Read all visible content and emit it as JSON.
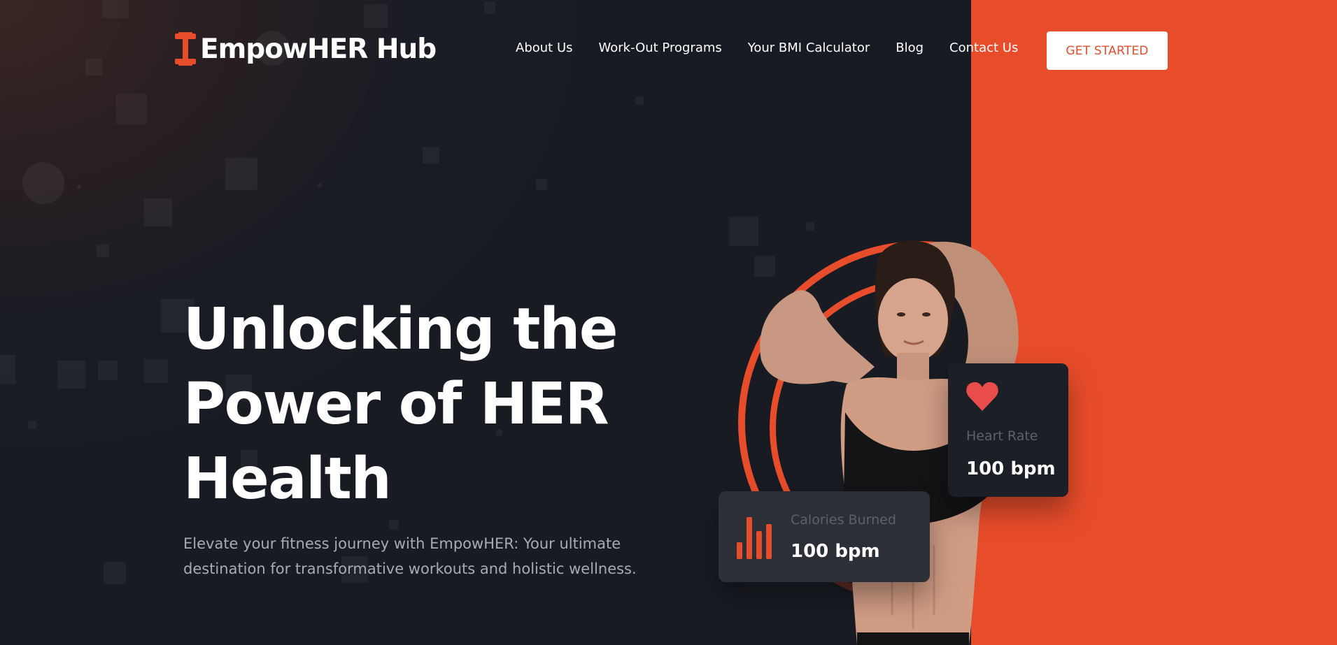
{
  "brand": {
    "name": "EmpowHER Hub",
    "logo_icon": "dumbbell-icon",
    "accent_color": "#e84d2b",
    "dark_color": "#191c23"
  },
  "nav": {
    "items": [
      {
        "label": "About Us"
      },
      {
        "label": "Work-Out Programs"
      },
      {
        "label": "Your BMI Calculator"
      },
      {
        "label": "Blog"
      },
      {
        "label": "Contact Us"
      }
    ],
    "cta_label": "GET STARTED"
  },
  "hero": {
    "title_lines": [
      "Unlocking the",
      "Power of HER",
      "Health"
    ],
    "subtitle_line1": "Elevate your fitness journey with EmpowHER: Your ultimate",
    "subtitle_line2": "destination for transformative workouts and holistic wellness."
  },
  "stats": {
    "heart": {
      "label": "Heart Rate",
      "value": "100 bpm",
      "icon": "heart-icon"
    },
    "calories": {
      "label": "Calories Burned",
      "value": "100 bpm",
      "icon": "bar-chart-icon"
    }
  }
}
